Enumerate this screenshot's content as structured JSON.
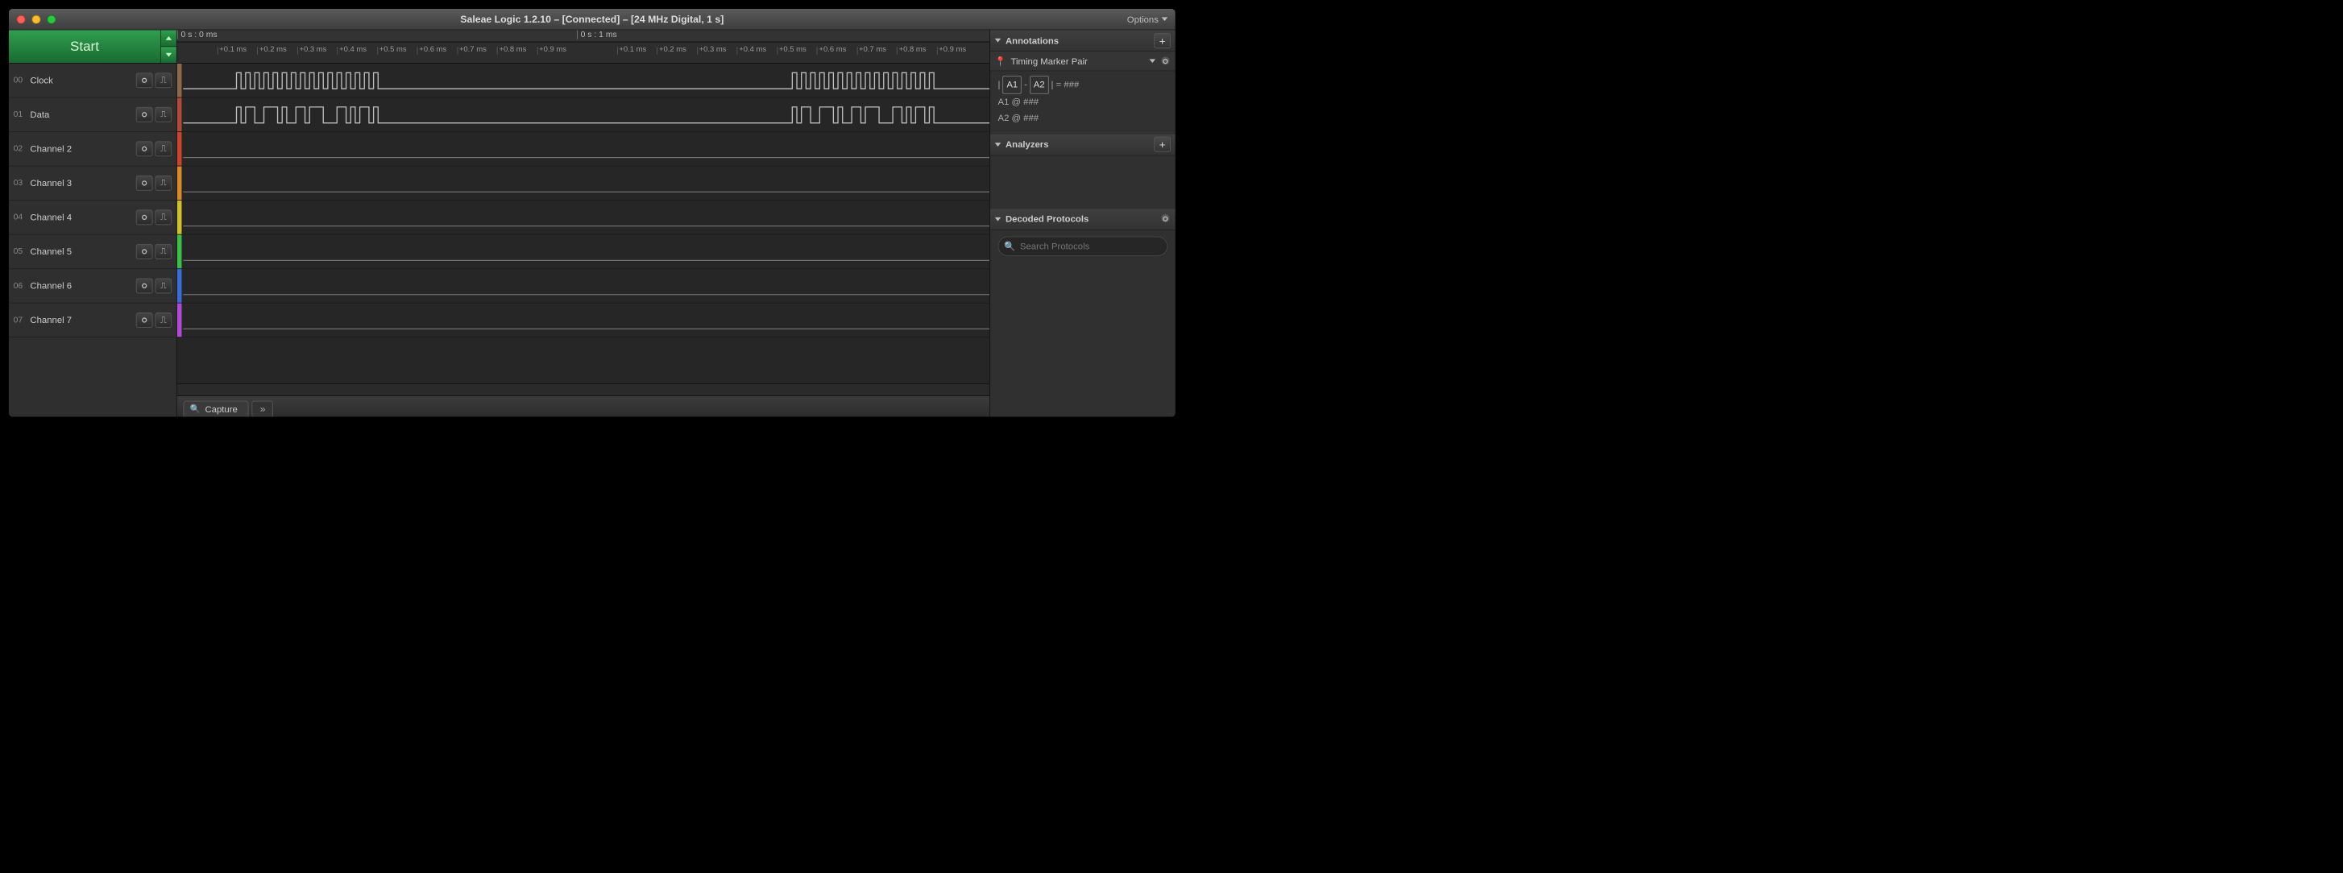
{
  "titlebar": {
    "title": "Saleae Logic 1.2.10 – [Connected] – [24 MHz Digital, 1 s]",
    "options_label": "Options"
  },
  "start_button": {
    "label": "Start"
  },
  "channels": [
    {
      "index": "00",
      "name": "Clock",
      "color": "#8d6a4a"
    },
    {
      "index": "01",
      "name": "Data",
      "color": "#b24a3a"
    },
    {
      "index": "02",
      "name": "Channel 2",
      "color": "#c9442b"
    },
    {
      "index": "03",
      "name": "Channel 3",
      "color": "#d88a2b"
    },
    {
      "index": "04",
      "name": "Channel 4",
      "color": "#cfc12b"
    },
    {
      "index": "05",
      "name": "Channel 5",
      "color": "#3bbf4a"
    },
    {
      "index": "06",
      "name": "Channel 6",
      "color": "#3b6bd8"
    },
    {
      "index": "07",
      "name": "Channel 7",
      "color": "#b24ad8"
    }
  ],
  "ruler": {
    "major": [
      "0 s : 0 ms",
      "0 s : 1 ms"
    ],
    "minor": [
      "+0.1 ms",
      "+0.2 ms",
      "+0.3 ms",
      "+0.4 ms",
      "+0.5 ms",
      "+0.6 ms",
      "+0.7 ms",
      "+0.8 ms",
      "+0.9 ms"
    ]
  },
  "right": {
    "annotations": {
      "title": "Annotations",
      "sub_title": "Timing Marker Pair",
      "line1_pre": "| ",
      "m1": "A1",
      "dash": " - ",
      "m2": "A2",
      "line1_post": " | = ###",
      "line2": "A1  @  ###",
      "line3": "A2  @  ###"
    },
    "analyzers": {
      "title": "Analyzers"
    },
    "decoded": {
      "title": "Decoded Protocols",
      "search_placeholder": "Search Protocols"
    }
  },
  "footer": {
    "tab_label": "Capture"
  }
}
